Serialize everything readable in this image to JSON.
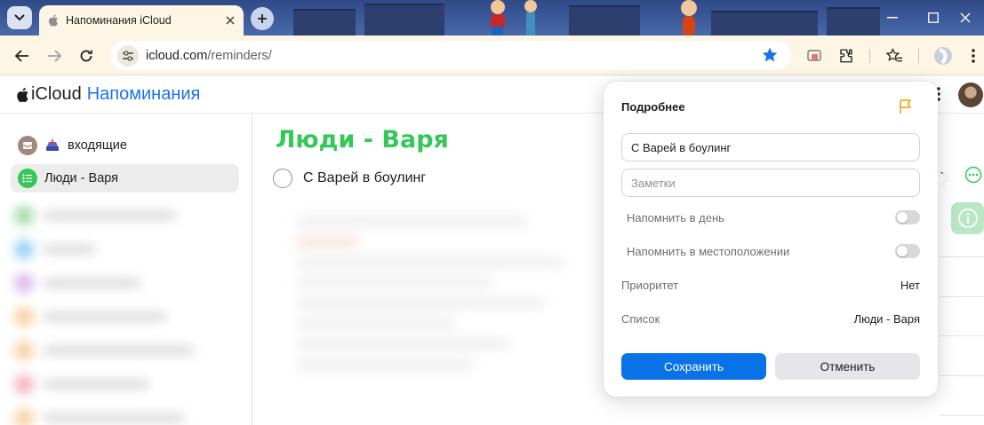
{
  "browser": {
    "tab_title": "Напоминания iCloud",
    "url_host": "icloud.com",
    "url_path": "/reminders/"
  },
  "app": {
    "brand_icloud": "iCloud",
    "brand_app": "Напоминания"
  },
  "sidebar": {
    "items": [
      {
        "label": "входящие",
        "icon": "inbox-icon"
      },
      {
        "label": "Люди - Варя",
        "icon": "list-icon",
        "color": "#34c759"
      }
    ]
  },
  "main": {
    "list_title": "Люди - Варя",
    "reminders": [
      {
        "text": "С Варей в боулинг"
      }
    ]
  },
  "details": {
    "title": "Подробнее",
    "title_value": "С Варей в боулинг",
    "notes_placeholder": "Заметки",
    "remind_day_label": "Напомнить в день",
    "remind_location_label": "Напомнить в местоположении",
    "priority_label": "Приоритет",
    "priority_value": "Нет",
    "list_label": "Список",
    "list_value": "Люди - Варя",
    "save_label": "Сохранить",
    "cancel_label": "Отменить"
  },
  "colors": {
    "accent_blue": "#0a72e8",
    "list_green": "#34c759",
    "flag_orange": "#f5a623"
  }
}
